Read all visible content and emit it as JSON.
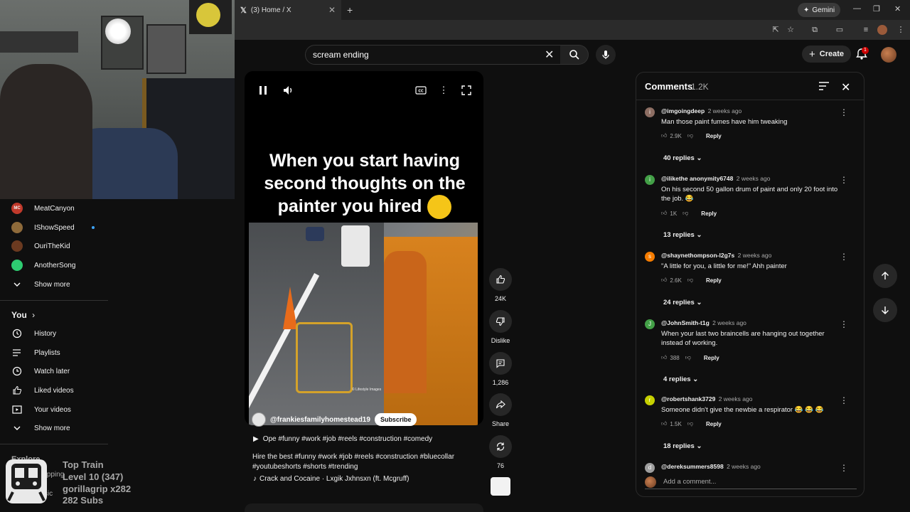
{
  "browser": {
    "tab_title": "(3) Home / X",
    "new_tab": "+",
    "gemini_label": "Gemini",
    "minimize": "—",
    "restore": "❐",
    "close": "✕"
  },
  "header": {
    "search_value": "scream ending",
    "create_label": "Create",
    "notification_count": "1"
  },
  "sidebar": {
    "subscriptions": [
      {
        "name": "MeatCanyon",
        "color": "#c0392b",
        "initials": "MC"
      },
      {
        "name": "IShowSpeed",
        "color": "#8e6a3a",
        "initials": ""
      },
      {
        "name": "OuriTheKid",
        "color": "#6b3a20",
        "initials": ""
      },
      {
        "name": "AnotherSong",
        "color": "#2ecc71",
        "initials": ""
      }
    ],
    "show_more": "Show more",
    "you_label": "You",
    "you_items": [
      {
        "label": "History",
        "icon": "history-icon"
      },
      {
        "label": "Playlists",
        "icon": "playlists-icon"
      },
      {
        "label": "Watch later",
        "icon": "watch-later-icon"
      },
      {
        "label": "Liked videos",
        "icon": "like-icon"
      },
      {
        "label": "Your videos",
        "icon": "your-videos-icon"
      }
    ],
    "show_more_2": "Show more",
    "explore_label": "Explore",
    "shopping_label": "Shopping",
    "music_label": "Music"
  },
  "overlay": {
    "line1": "Top Train",
    "line2": "Level 10  (347)",
    "line3": "gorillagrip x282",
    "line4": "282 Subs"
  },
  "video": {
    "caption": "When you start having second thoughts on the painter you hired",
    "channel": "@frankiesfamilyhomestead19",
    "subscribe": "Subscribe",
    "title_line": "Ope #funny #work #job #reels #construction #comedy",
    "description": "Hire the best #funny #work #job #reels #construction #bluecollar #youtubeshorts #shorts #trending",
    "music": "Crack and Cocaine · Lxgik Jxhnsxn (ft. Mcgruff)",
    "watermark": "© Lifestyle Images"
  },
  "actions": {
    "likes": "24K",
    "dislike": "Dislike",
    "comments": "1,286",
    "share": "Share",
    "remix": "76"
  },
  "comments_panel": {
    "title": "Comments",
    "count": "1.2K",
    "add_placeholder": "Add a comment...",
    "reply_label": "Reply",
    "items": [
      {
        "author": "@imgoingdeep",
        "time": "2 weeks ago",
        "text": "Man those paint fumes have him tweaking",
        "likes": "2.9K",
        "replies": "40 replies",
        "avatar_color": "#8d6e63",
        "avatar_letter": "i"
      },
      {
        "author": "@ilikethe anonymity6748",
        "time": "2 weeks ago",
        "text": "On his second 50 gallon drum of paint and only 20 foot into the job.  😂",
        "likes": "1K",
        "replies": "13 replies",
        "avatar_color": "#43a047",
        "avatar_letter": "i"
      },
      {
        "author": "@shaynethompson-l2g7s",
        "time": "2 weeks ago",
        "text": "\"A little for you, a little for me!\" Ahh painter",
        "likes": "2.6K",
        "replies": "24 replies",
        "avatar_color": "#f57c00",
        "avatar_letter": "s"
      },
      {
        "author": "@JohnSmith-t1g",
        "time": "2 weeks ago",
        "text": "When your last two braincells are hanging out together instead of working.",
        "likes": "388",
        "replies": "4 replies",
        "avatar_color": "#43a047",
        "avatar_letter": "J"
      },
      {
        "author": "@robertshank3729",
        "time": "2 weeks ago",
        "text": "Someone didn't give the newbie a respirator 😂 😂 😂",
        "likes": "1.5K",
        "replies": "18 replies",
        "avatar_color": "#c6d000",
        "avatar_letter": "r"
      },
      {
        "author": "@dereksummers8598",
        "time": "2 weeks ago",
        "text": "",
        "likes": "",
        "replies": "",
        "avatar_color": "#9e9e9e",
        "avatar_letter": "d"
      }
    ]
  }
}
